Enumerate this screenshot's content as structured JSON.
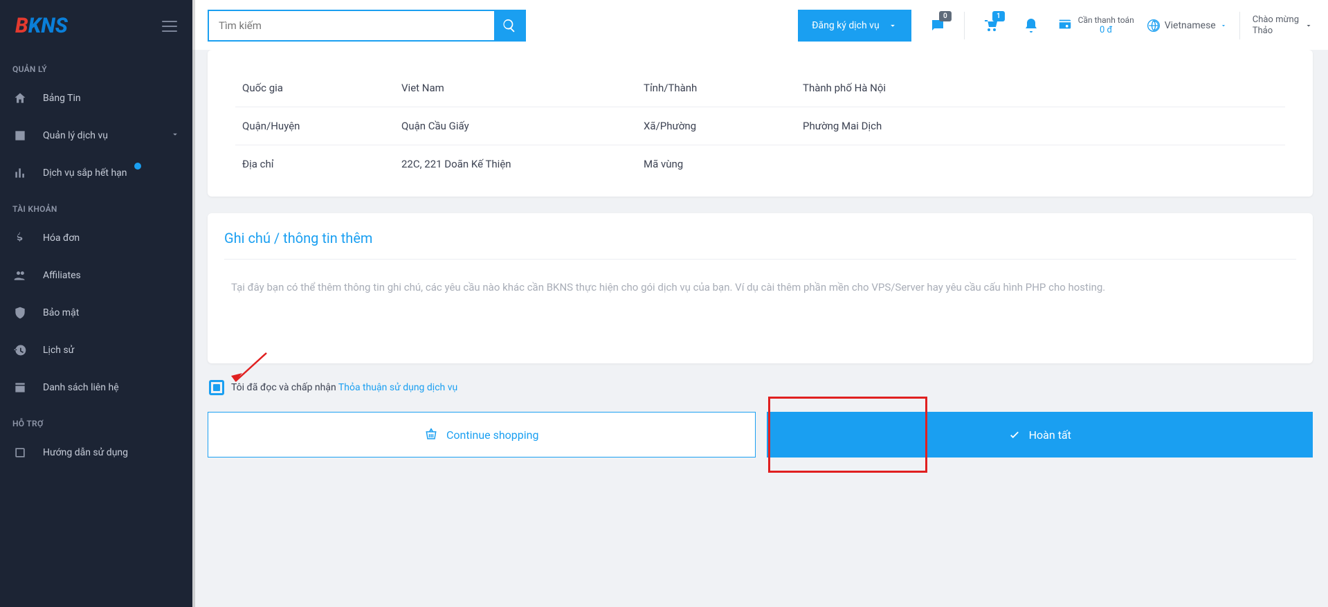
{
  "header": {
    "search_placeholder": "Tìm kiếm",
    "register_label": "Đăng ký dịch vụ",
    "alert_badge": "0",
    "cart_badge": "1",
    "pay_label": "Cần thanh toán",
    "pay_amount": "0 đ",
    "language": "Vietnamese",
    "greeting_line1": "Chào mừng",
    "greeting_line2": "Thảo"
  },
  "sidebar": {
    "sections": {
      "manage": "QUẢN LÝ",
      "account": "TÀI KHOẢN",
      "support": "HỖ TRỢ"
    },
    "items": {
      "dashboard": "Bảng Tin",
      "services": "Quản lý dịch vụ",
      "expiring": "Dịch vụ sắp hết hạn",
      "invoice": "Hóa đơn",
      "affiliates": "Affiliates",
      "security": "Bảo mật",
      "history": "Lịch sử",
      "contacts": "Danh sách liên hệ",
      "guide": "Hướng dẫn sử dụng"
    }
  },
  "info": {
    "rows": [
      {
        "l1": "Quốc gia",
        "v1": "Viet Nam",
        "l2": "Tỉnh/Thành",
        "v2": "Thành phố Hà Nội"
      },
      {
        "l1": "Quận/Huyện",
        "v1": "Quận Cầu Giấy",
        "l2": "Xã/Phường",
        "v2": "Phường Mai Dịch"
      },
      {
        "l1": "Địa chỉ",
        "v1": "22C, 221 Doãn Kế Thiện",
        "l2": "Mã vùng",
        "v2": ""
      }
    ]
  },
  "notes": {
    "title": "Ghi chú / thông tin thêm",
    "placeholder": "Tại đây bạn có thể thêm thông tin ghi chú, các yêu cầu nào khác cần BKNS thực hiện cho gói dịch vụ của bạn. Ví dụ cài thêm phần mền cho VPS/Server hay yêu cầu cấu hình PHP cho hosting."
  },
  "tos": {
    "prefix": "Tôi đã đọc và chấp nhận ",
    "link": "Thỏa thuận sử dụng dịch vụ"
  },
  "buttons": {
    "continue": "Continue shopping",
    "complete": "Hoàn tất"
  }
}
